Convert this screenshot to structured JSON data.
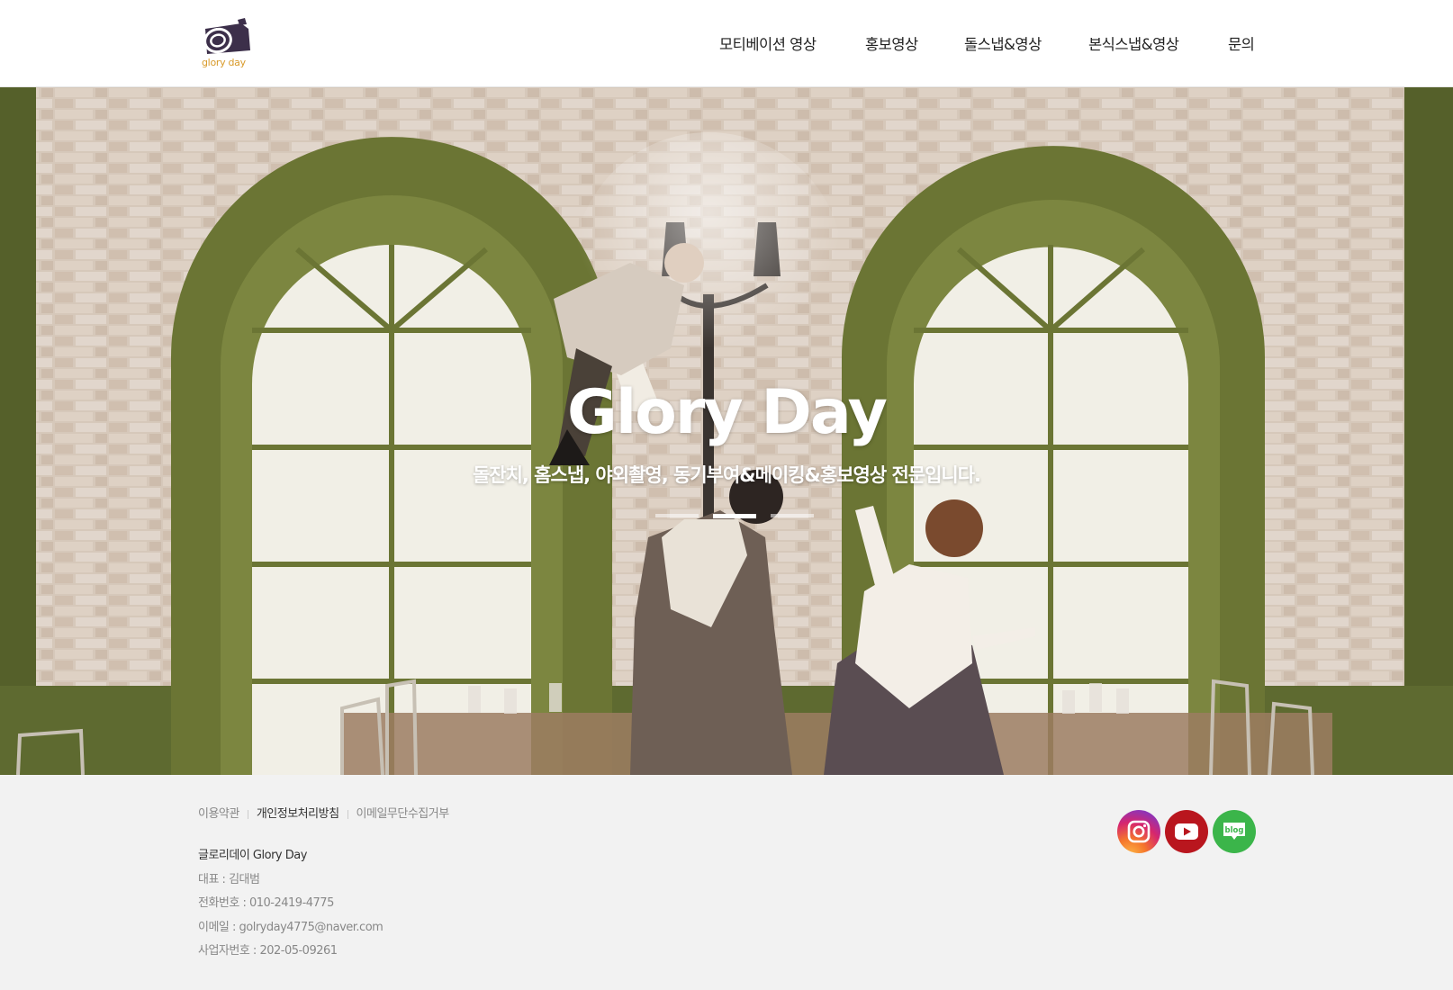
{
  "header": {
    "logo_text": "glory day",
    "nav": [
      {
        "label": "모티베이션 영상"
      },
      {
        "label": "홍보영상"
      },
      {
        "label": "돌스냅&영상"
      },
      {
        "label": "본식스냅&영상"
      },
      {
        "label": "문의"
      }
    ]
  },
  "hero": {
    "title": "Glory Day",
    "subtitle": "돌잔치, 홈스냅, 야외촬영, 동기부여&메이킹&홍보영상 전문입니다.",
    "slides_total": 3,
    "active_slide": 2
  },
  "footer": {
    "links": [
      {
        "label": "이용약관"
      },
      {
        "label": "개인정보처리방침"
      },
      {
        "label": "이메일무단수집거부"
      }
    ],
    "company": "글로리데이 Glory Day",
    "ceo": "대표 : 김대범",
    "phone": "전화번호 : 010-2419-4775",
    "email": "이메일 : golryday4775@naver.com",
    "biz_no": "사업자번호 : 202-05-09261",
    "social": [
      {
        "icon": "instagram-icon",
        "color": "#d6266e"
      },
      {
        "icon": "youtube-icon",
        "color": "#b9161e"
      },
      {
        "icon": "blog-icon",
        "color": "#3bb54a",
        "label": "blog"
      }
    ]
  }
}
